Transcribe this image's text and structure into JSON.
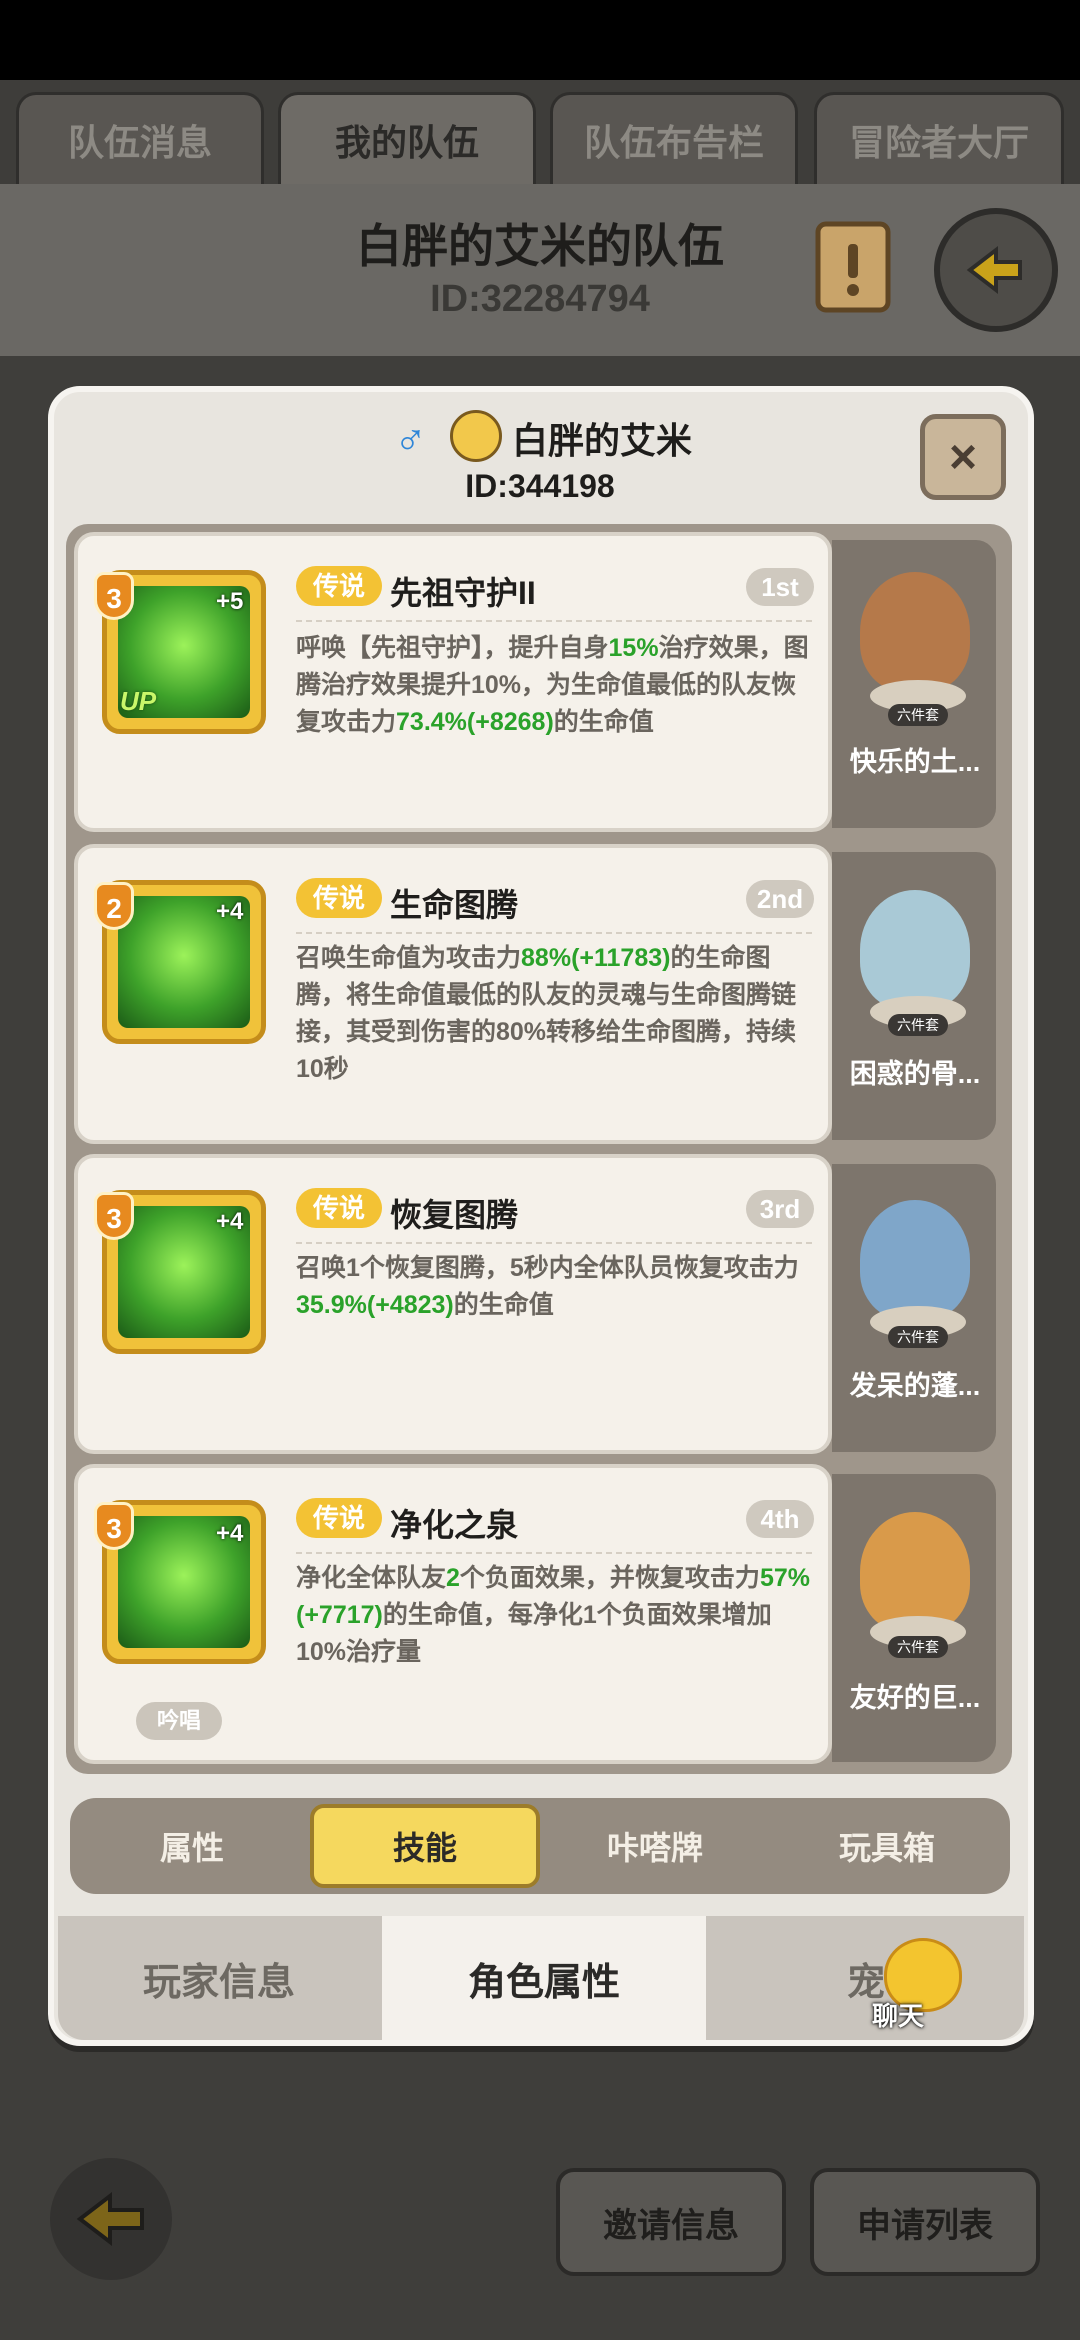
{
  "top_tabs": [
    "队伍消息",
    "我的队伍",
    "队伍布告栏",
    "冒险者大厅"
  ],
  "team": {
    "name": "白胖的艾米的队伍",
    "id": "ID:32284794"
  },
  "player": {
    "gender_symbol": "♂",
    "name": "白胖的艾米",
    "id": "ID:344198"
  },
  "close_label": "×",
  "skills": [
    {
      "level": "3",
      "plus": "+5",
      "up": "UP",
      "rarity": "传说",
      "name": "先祖守护II",
      "rank": "1st",
      "desc": [
        "呼唤【先祖守护】，提升自身",
        "15%",
        "治疗效果，图腾治疗效果提升10%，为生命值最低的队友恢复攻击力",
        "73.4%",
        "(+8268)",
        "的生命值"
      ],
      "companion": {
        "name": "快乐的土...",
        "tag": "六件套"
      }
    },
    {
      "level": "2",
      "plus": "+4",
      "rarity": "传说",
      "name": "生命图腾",
      "rank": "2nd",
      "desc": [
        "召唤生命值为攻击力",
        "88%",
        "(+11783)",
        "的生命图腾，将生命值最低的队友的灵魂与生命图腾链接，其受到伤害的80%转移给生命图腾，持续10秒"
      ],
      "companion": {
        "name": "困惑的骨...",
        "tag": "六件套"
      }
    },
    {
      "level": "3",
      "plus": "+4",
      "rarity": "传说",
      "name": "恢复图腾",
      "rank": "3rd",
      "desc": [
        "召唤1个恢复图腾，5秒内全体队员恢复攻击力",
        "35.9%",
        "(+4823)",
        "的生命值"
      ],
      "companion": {
        "name": "发呆的蓬...",
        "tag": "六件套"
      }
    },
    {
      "level": "3",
      "plus": "+4",
      "rarity": "传说",
      "name": "净化之泉",
      "rank": "4th",
      "desc": [
        "净化全体队友",
        "2",
        "个负面效果，并恢复攻击力",
        "57%",
        "(+7717)",
        "的生命值，每净化1个负面效果增加10%治疗量"
      ],
      "chant": "吟唱",
      "companion": {
        "name": "友好的巨...",
        "tag": "六件套"
      }
    }
  ],
  "sub_tabs": [
    "属性",
    "技能",
    "咔嗒牌",
    "玩具箱"
  ],
  "bottom_tabs": [
    "玩家信息",
    "角色属性",
    "宠"
  ],
  "chat_label": "聊天",
  "bottom_buttons": [
    "邀请信息",
    "申请列表"
  ],
  "colors": {
    "accent_yellow": "#f3c234",
    "highlight_green": "#2aa22a",
    "panel_bg": "#e8e5df"
  }
}
